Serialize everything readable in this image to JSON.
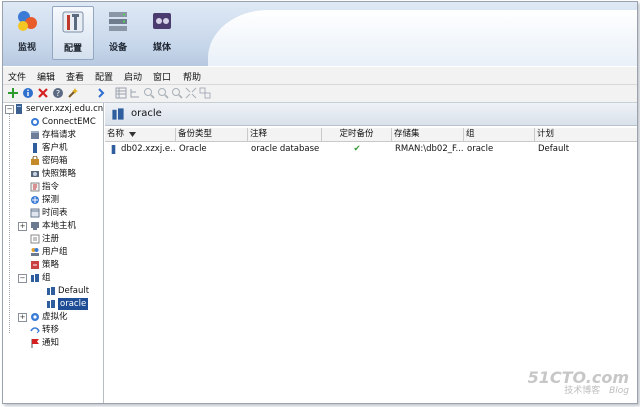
{
  "nav": {
    "buttons": [
      {
        "label": "监视",
        "icon": "monitor-icon"
      },
      {
        "label": "配置",
        "icon": "configure-tools-icon",
        "selected": true
      },
      {
        "label": "设备",
        "icon": "devices-icon"
      },
      {
        "label": "媒体",
        "icon": "media-icon"
      }
    ]
  },
  "menu": [
    "文件",
    "编辑",
    "查看",
    "配置",
    "启动",
    "窗口",
    "帮助"
  ],
  "tree": {
    "root": "server.xzxj.edu.cn",
    "items": [
      "ConnectEMC",
      "存档请求",
      "客户机",
      "密码箱",
      "快照策略",
      "指令",
      "探测",
      "时间表",
      "本地主机",
      "注册",
      "用户组",
      "策略",
      "组",
      "Default",
      "oracle",
      "虚拟化",
      "转移",
      "通知"
    ]
  },
  "panel": {
    "title": "oracle"
  },
  "table": {
    "columns": [
      "名称",
      "备份类型",
      "注释",
      "定时备份",
      "存储集",
      "组",
      "计划"
    ],
    "rows": [
      {
        "name": "db02.xzxj.e...",
        "type": "Oracle",
        "comment": "oracle database",
        "scheduled": "✔",
        "storage": "RMAN:\\db02_F...",
        "group": "oracle",
        "schedule": "Default"
      }
    ]
  },
  "watermark": {
    "site": "51CTO.com",
    "sub": "技术博客",
    "blog": "Blog"
  },
  "colors": {
    "accent": "#1f4e96",
    "check": "#2e9b2e"
  }
}
